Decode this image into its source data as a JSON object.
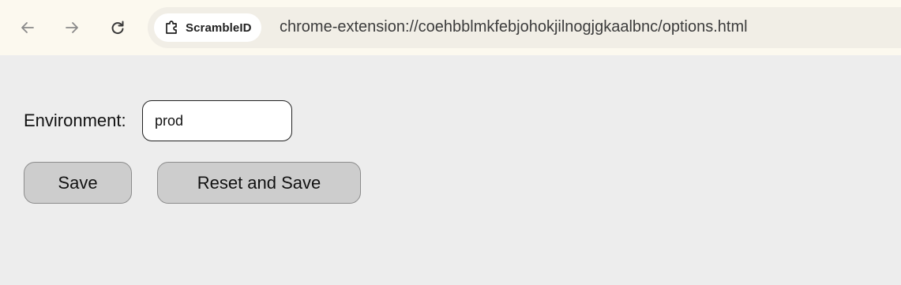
{
  "browser": {
    "nav": {
      "back_icon": "arrow-left-icon",
      "forward_icon": "arrow-right-icon",
      "reload_icon": "reload-icon"
    },
    "site_chip": {
      "icon": "puzzle-extension-icon",
      "label": "ScrambleID"
    },
    "url": "chrome-extension://coehbblmkfebjohokjilnogjgkaalbnc/options.html"
  },
  "options": {
    "environment_label": "Environment:",
    "environment_value": "prod",
    "save_label": "Save",
    "reset_label": "Reset and Save"
  },
  "colors": {
    "toolbar_bg": "#fcf9ef",
    "page_bg": "#ededed",
    "button_bg": "#cdcdcd"
  }
}
